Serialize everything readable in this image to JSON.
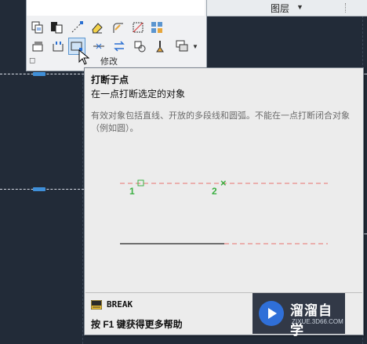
{
  "ribbon": {
    "layers_label": "图层"
  },
  "panel": {
    "title": "修改"
  },
  "tooltip": {
    "title": "打断于点",
    "description": "在一点打断选定的对象",
    "detail": "有效对象包括直线、开放的多段线和圆弧。不能在一点打断闭合对象（例如圆）。",
    "point_1": "1",
    "point_2": "2",
    "command": "BREAK",
    "help": "按 F1 键获得更多帮助"
  },
  "watermark": {
    "name": "溜溜自学",
    "url": "ZIXUE.3D66.COM"
  },
  "colors": {
    "accent_green": "#3cb043",
    "dashed_red": "#e8726e",
    "canvas_bg": "#222b38"
  }
}
